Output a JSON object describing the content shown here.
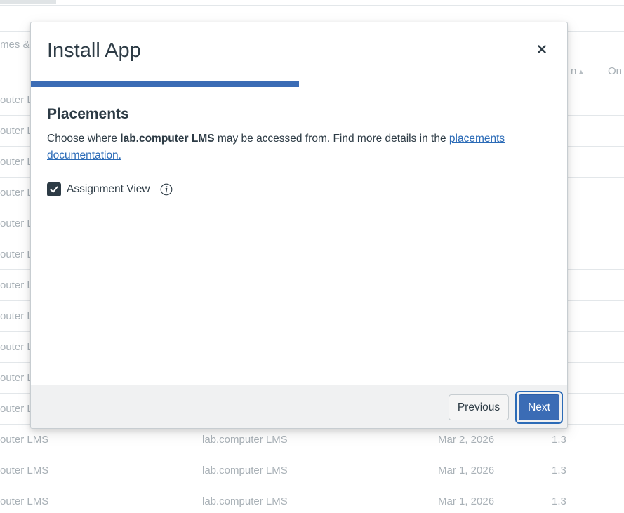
{
  "background": {
    "filter_text": "mes &",
    "table_headers": {
      "col1": "n",
      "col2": "On"
    },
    "rows": [
      {
        "name": "outer L",
        "creator": "",
        "date": "",
        "version": ""
      },
      {
        "name": "outer L",
        "creator": "",
        "date": "",
        "version": ""
      },
      {
        "name": "outer L",
        "creator": "",
        "date": "",
        "version": ""
      },
      {
        "name": "outer L",
        "creator": "",
        "date": "",
        "version": ""
      },
      {
        "name": "outer L",
        "creator": "",
        "date": "",
        "version": ""
      },
      {
        "name": "outer L",
        "creator": "",
        "date": "",
        "version": ""
      },
      {
        "name": "outer L",
        "creator": "",
        "date": "",
        "version": ""
      },
      {
        "name": "outer L",
        "creator": "",
        "date": "",
        "version": ""
      },
      {
        "name": "outer L",
        "creator": "",
        "date": "",
        "version": ""
      },
      {
        "name": "outer L",
        "creator": "",
        "date": "",
        "version": ""
      },
      {
        "name": "outer L",
        "creator": "",
        "date": "",
        "version": ""
      },
      {
        "name": "outer LMS",
        "creator": "lab.computer LMS",
        "date": "Mar 2, 2026",
        "version": "1.3"
      },
      {
        "name": "outer LMS",
        "creator": "lab.computer LMS",
        "date": "Mar 1, 2026",
        "version": "1.3"
      },
      {
        "name": "outer LMS",
        "creator": "lab.computer LMS",
        "date": "Mar 1, 2026",
        "version": "1.3"
      }
    ]
  },
  "modal": {
    "title": "Install App",
    "close_icon": "close-icon",
    "progress": 0.5,
    "progress_color": "#3b6cb5",
    "section_title": "Placements",
    "description": {
      "prefix": "Choose where ",
      "app_name": "lab.computer LMS",
      "middle": " may be accessed from. Find more details in the ",
      "link_text": "placements documentation."
    },
    "placements": [
      {
        "label": "Assignment View",
        "checked": true,
        "info_icon": "info-icon"
      }
    ],
    "footer": {
      "previous_label": "Previous",
      "next_label": "Next"
    }
  },
  "colors": {
    "primary": "#3b6cb5",
    "text": "#2d3b45",
    "link": "#2b6bb7",
    "muted": "#a9b1b7"
  }
}
